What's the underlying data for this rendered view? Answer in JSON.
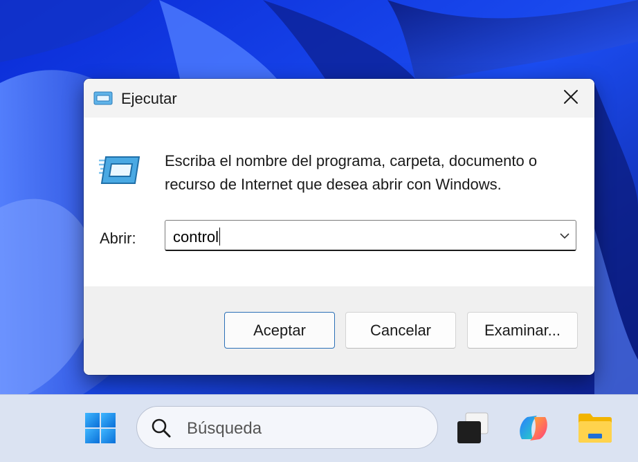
{
  "dialog": {
    "title": "Ejecutar",
    "description_line1": "Escriba el nombre del programa, carpeta, documento o",
    "description_line2": "recurso de Internet que desea abrir con Windows.",
    "open_label": "Abrir:",
    "open_value": "control",
    "buttons": {
      "ok": "Aceptar",
      "cancel": "Cancelar",
      "browse": "Examinar..."
    },
    "icons": {
      "title": "run-icon",
      "content": "run-icon",
      "close": "close-icon",
      "dropdown": "chevron-down-icon"
    }
  },
  "taskbar": {
    "search_placeholder": "Búsqueda",
    "icons": [
      "windows-start-icon",
      "search-icon",
      "task-view-icon",
      "copilot-icon",
      "file-explorer-icon"
    ]
  },
  "colors": {
    "wallpaper": "#1a3fd0",
    "accent_border": "#2a6fb6",
    "taskbar": "#dbe3f2"
  }
}
